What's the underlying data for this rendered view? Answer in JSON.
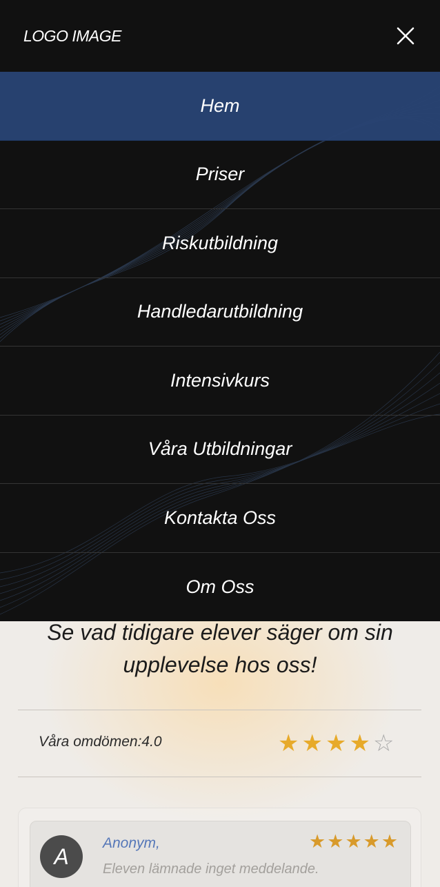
{
  "menu": {
    "logo_text": "LOGO IMAGE",
    "close_icon": "close-icon",
    "items": [
      {
        "label": "Hem",
        "active": true
      },
      {
        "label": "Priser"
      },
      {
        "label": "Riskutbildning"
      },
      {
        "label": "Handledarutbildning"
      },
      {
        "label": "Intensivkurs"
      },
      {
        "label": "Våra Utbildningar"
      },
      {
        "label": "Kontakta Oss"
      },
      {
        "label": "Om Oss"
      }
    ]
  },
  "testimonials": {
    "heading": "Se vad tidigare elever säger om sin upplevelse hos oss!",
    "rating_label": "Våra omdömen:4.0",
    "rating_value": 4,
    "rating_max": 5,
    "review": {
      "avatar_letter": "A",
      "name": "Anonym,",
      "text": "Eleven lämnade inget meddelande.",
      "stars": 5
    }
  },
  "colors": {
    "menu_bg": "#111111",
    "active_item": "#284373",
    "star": "#e7aa2a",
    "reviewer_name": "#5577b8"
  }
}
